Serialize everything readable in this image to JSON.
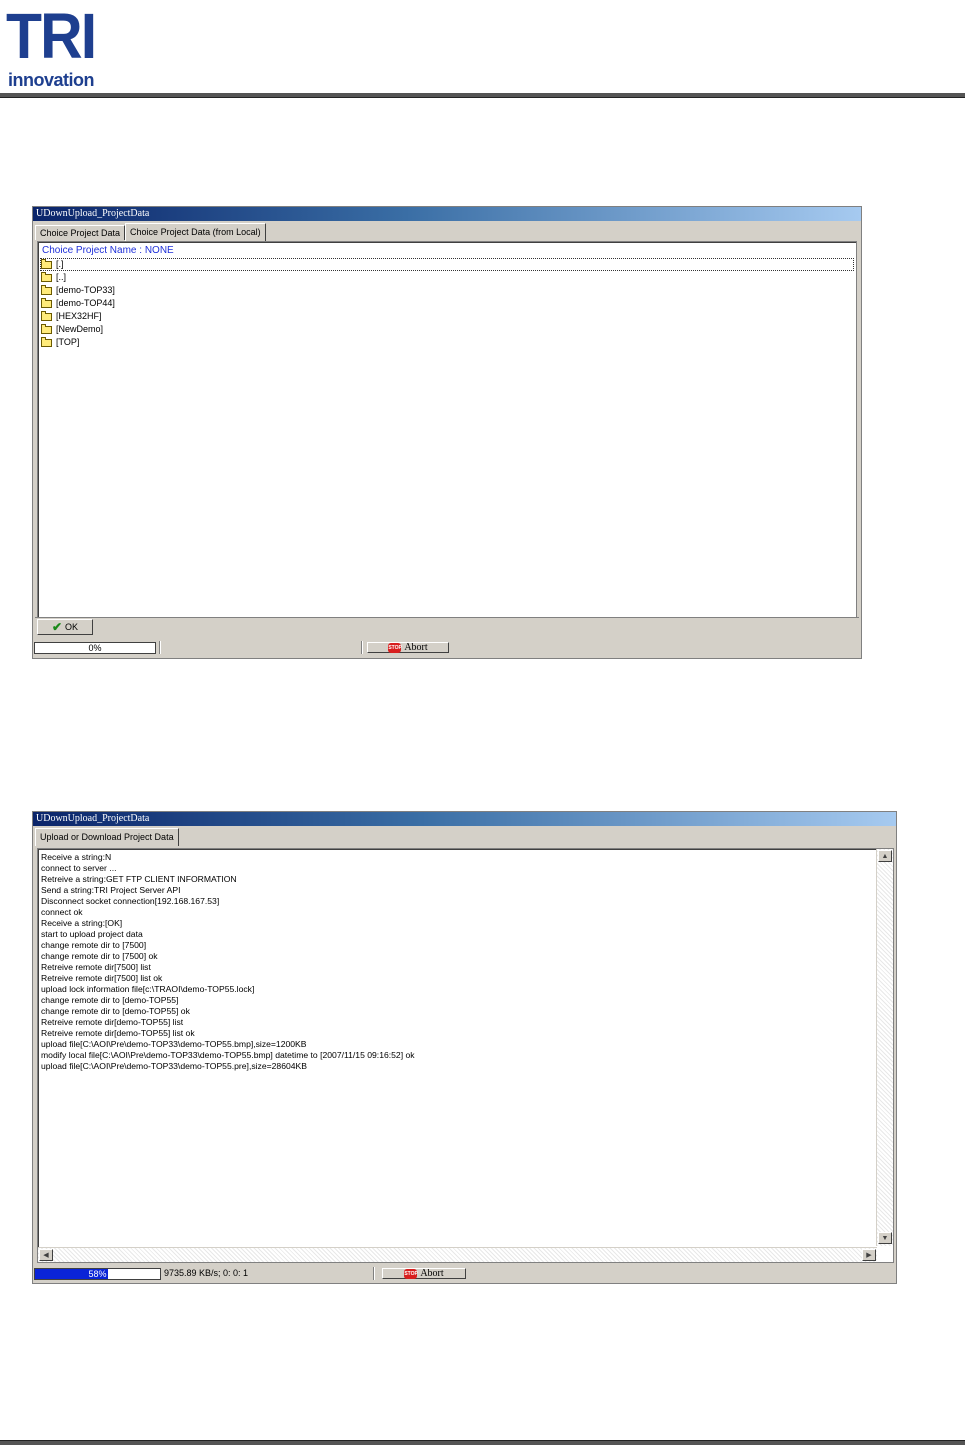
{
  "logo": {
    "main": "TRI",
    "sub": "innovation"
  },
  "window1": {
    "title": "UDownUpload_ProjectData",
    "tabs": [
      "Choice Project Data",
      "Choice Project Data (from Local)"
    ],
    "active_tab": 1,
    "choice_label": "Choice Project Name : NONE",
    "folders": [
      "[.]",
      "[..]",
      "[demo-TOP33]",
      "[demo-TOP44]",
      "[HEX32HF]",
      "[NewDemo]",
      "[TOP]"
    ],
    "ok_label": "OK",
    "progress_text": "0%",
    "progress_value": 0,
    "abort_label": "Abort",
    "stop_text": "STOP"
  },
  "window2": {
    "title": "UDownUpload_ProjectData",
    "tab": "Upload or Download Project Data",
    "log": [
      "Receive a string:N",
      "connect to server ...",
      "Retreive a string:GET FTP CLIENT INFORMATION",
      "Send a string:TRI Project Server API",
      "Disconnect socket connection[192.168.167.53]",
      "connect ok",
      "Receive a string:[OK]",
      "start to upload project data",
      "change remote dir to [7500]",
      "change remote dir to [7500] ok",
      "Retreive remote dir[7500] list",
      "Retreive remote dir[7500] list ok",
      "upload lock information file[c:\\TRAOI\\demo-TOP55.lock]",
      "change remote dir to [demo-TOP55]",
      "change remote dir to [demo-TOP55] ok",
      "Retreive remote dir[demo-TOP55] list",
      "Retreive remote dir[demo-TOP55] list ok",
      "upload file[C:\\AOI\\Pre\\demo-TOP33\\demo-TOP55.bmp],size=1200KB",
      "modify local file[C:\\AOI\\Pre\\demo-TOP33\\demo-TOP55.bmp] datetime to [2007/11/15 09:16:52] ok",
      "upload file[C:\\AOI\\Pre\\demo-TOP33\\demo-TOP55.pre],size=28604KB"
    ],
    "progress_text": "58%",
    "progress_value": 0.58,
    "speed": "9735.89 KB/s; 0: 0: 1",
    "abort_label": "Abort",
    "stop_text": "STOP"
  },
  "colors": {
    "brand": "#1e3f8f",
    "titlebar_start": "#0a246a",
    "progress_fill": "#0a24d8",
    "choice_label": "#1e2fd8"
  }
}
